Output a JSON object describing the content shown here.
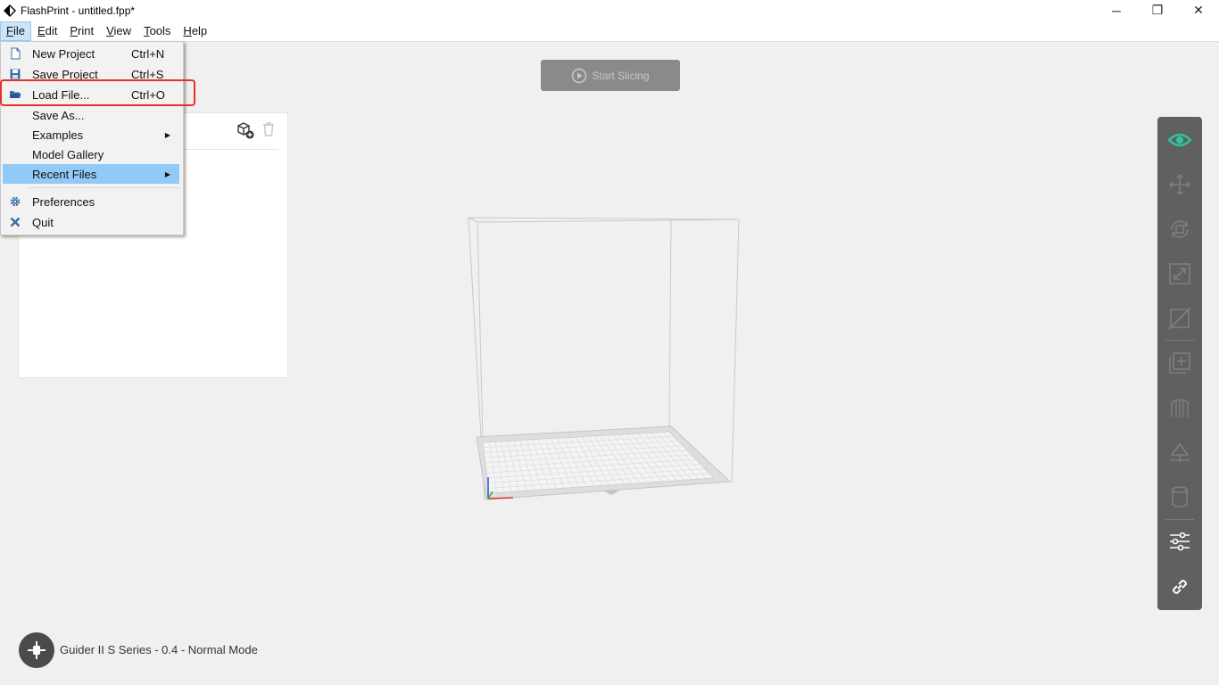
{
  "window": {
    "title": "FlashPrint - untitled.fpp*",
    "controls": {
      "minimize": "─",
      "restore": "❐",
      "close": "✕"
    }
  },
  "menubar": {
    "items": [
      {
        "label": "File",
        "key": "F",
        "rest": "ile",
        "active": true
      },
      {
        "label": "Edit",
        "key": "E",
        "rest": "dit"
      },
      {
        "label": "Print",
        "key": "P",
        "rest": "rint"
      },
      {
        "label": "View",
        "key": "V",
        "rest": "iew"
      },
      {
        "label": "Tools",
        "key": "T",
        "rest": "ools"
      },
      {
        "label": "Help",
        "key": "H",
        "rest": "elp"
      }
    ]
  },
  "file_menu": {
    "items": [
      {
        "label": "New Project",
        "shortcut": "Ctrl+N",
        "icon": "new-project-icon"
      },
      {
        "label": "Save Project",
        "shortcut": "Ctrl+S",
        "icon": "save-icon"
      },
      {
        "label": "Load File...",
        "shortcut": "Ctrl+O",
        "icon": "folder-open-icon"
      },
      {
        "label": "Save As...",
        "shortcut": ""
      },
      {
        "label": "Examples",
        "submenu": true
      },
      {
        "label": "Model Gallery"
      },
      {
        "label": "Recent Files",
        "submenu": true,
        "highlighted": true
      },
      {
        "label": "Preferences",
        "icon": "gear-icon"
      },
      {
        "label": "Quit",
        "icon": "close-x-icon"
      }
    ]
  },
  "toolbar": {
    "start_slicing": "Start Slicing"
  },
  "status": {
    "printer_mode": "Guider II S Series - 0.4 - Normal Mode"
  },
  "right_toolbar": {
    "buttons": [
      "view-icon",
      "move-icon",
      "rotate-icon",
      "scale-icon",
      "cut-icon",
      "add-icon",
      "supports-icon",
      "leveling-icon",
      "cylinder-icon",
      "settings-sliders-icon",
      "link-icon"
    ]
  },
  "colors": {
    "accent_teal": "#2ec4a0",
    "highlight_blue": "#91c9f7",
    "red_box": "#e8302a",
    "toolbar_gray": "#606060"
  }
}
